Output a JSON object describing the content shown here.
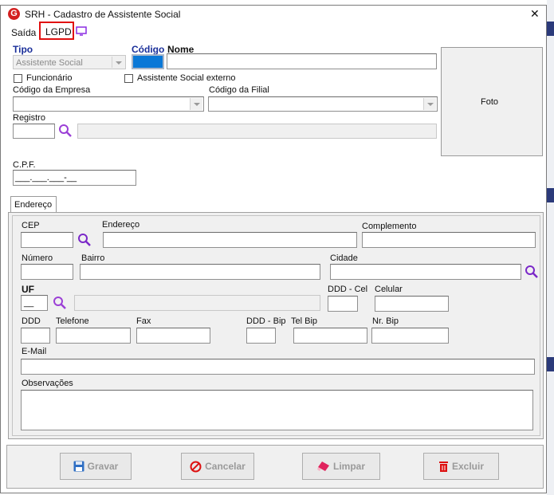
{
  "window": {
    "title": "SRH - Cadastro de Assistente Social",
    "close_glyph": "✕"
  },
  "menu": {
    "saida": "Saída",
    "lgpd": "LGPD"
  },
  "form": {
    "tipo_label": "Tipo",
    "tipo_value": "Assistente Social",
    "codigo_label": "Código",
    "nome_label": "Nome",
    "funcionario_label": "Funcionário",
    "assistente_externo_label": "Assistente Social externo",
    "codigo_empresa_label": "Código da Empresa",
    "codigo_filial_label": "Código da Filial",
    "registro_label": "Registro",
    "foto_label": "Foto",
    "cpf_label": "C.P.F.",
    "cpf_mask": "___.___.___-__"
  },
  "tab": {
    "endereco": "Endereço"
  },
  "address": {
    "cep": "CEP",
    "endereco": "Endereço",
    "complemento": "Complemento",
    "numero": "Número",
    "bairro": "Bairro",
    "cidade": "Cidade",
    "uf": "UF",
    "uf_mask": "__",
    "ddd_cel": "DDD - Cel",
    "celular": "Celular",
    "ddd": "DDD",
    "telefone": "Telefone",
    "fax": "Fax",
    "ddd_bip": "DDD - Bip",
    "tel_bip": "Tel Bip",
    "nr_bip": "Nr. Bip",
    "email": "E-Mail",
    "observacoes": "Observações"
  },
  "buttons": {
    "gravar": "Gravar",
    "cancelar": "Cancelar",
    "limpar": "Limpar",
    "excluir": "Excluir"
  },
  "colors": {
    "accent": "#1a2f9a",
    "lgpd_highlight": "#e01010",
    "codigo_fill": "#0a78d7",
    "search_icon": "#9b3fd6"
  }
}
